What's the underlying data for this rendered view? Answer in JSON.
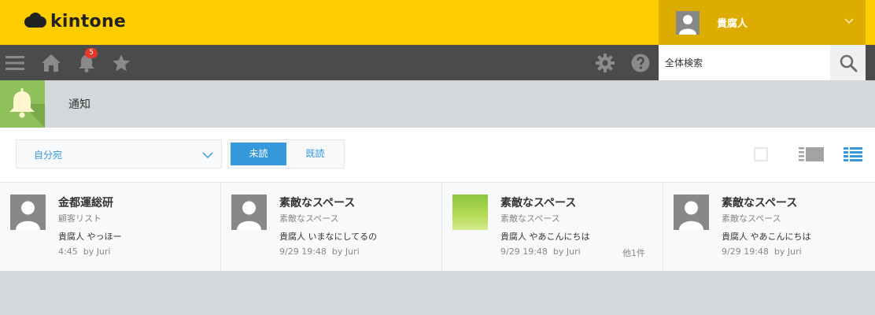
{
  "app": {
    "brand": "kintone"
  },
  "colors": {
    "header_yellow": "#fdcd00",
    "user_area": "#dcac00",
    "navbar": "#4b4b4b",
    "accent_blue": "#3498db",
    "badge_red": "#e5382d",
    "notification_green": "#8fc15a"
  },
  "header": {
    "user_name": "貴腐人",
    "user_icon": "person-icon",
    "menu_icon": "chevron-down-icon"
  },
  "navbar": {
    "icons": [
      "hamburger-menu-icon",
      "home-icon",
      "bell-icon",
      "star-icon",
      "gear-icon",
      "help-icon",
      "search-icon"
    ],
    "notification_count": "5",
    "search_placeholder": "全体検索"
  },
  "page": {
    "title": "通知",
    "icon": "bell-icon"
  },
  "toolbar": {
    "filter_selected": "自分宛",
    "tabs": [
      {
        "label": "未読",
        "active": true
      },
      {
        "label": "既読",
        "active": false
      }
    ],
    "view_icons": [
      "checkbox-icon",
      "preview-view-icon",
      "list-view-icon"
    ]
  },
  "notifications": [
    {
      "title": "金都運総研",
      "subtitle": "顧客リスト",
      "message": "貴腐人 やっほー",
      "time": "4:45",
      "by": "by Juri",
      "more": "",
      "avatar": "person"
    },
    {
      "title": "素敵なスペース",
      "subtitle": "素敵なスペース",
      "message": "貴腐人 いまなにしてるの",
      "time": "9/29 19:48",
      "by": "by Juri",
      "more": "",
      "avatar": "person"
    },
    {
      "title": "素敵なスペース",
      "subtitle": "素敵なスペース",
      "message": "貴腐人 やあこんにちは",
      "time": "9/29 19:48",
      "by": "by Juri",
      "more": "他1件",
      "avatar": "green"
    },
    {
      "title": "素敵なスペース",
      "subtitle": "素敵なスペース",
      "message": "貴腐人 やあこんにちは",
      "time": "9/29 19:48",
      "by": "by Juri",
      "more": "",
      "avatar": "person"
    }
  ]
}
